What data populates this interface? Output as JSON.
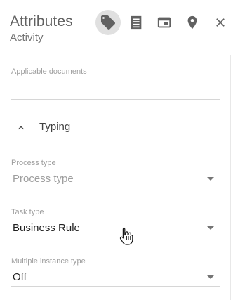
{
  "header": {
    "title": "Attributes",
    "subtitle": "Activity",
    "icons": [
      "tag-icon",
      "document-icon",
      "window-icon",
      "location-pin-icon",
      "close-icon"
    ],
    "active_tab": "tag-icon"
  },
  "fields": {
    "applicable_documents": {
      "label": "Applicable documents",
      "value": ""
    },
    "process_type": {
      "label": "Process type",
      "value": "Process type",
      "is_placeholder": true
    },
    "task_type": {
      "label": "Task type",
      "value": "Business Rule"
    },
    "multiple_instance_type": {
      "label": "Multiple instance type",
      "value": "Off"
    }
  },
  "section": {
    "title": "Typing",
    "expanded": true
  },
  "colors": {
    "icon": "#616161",
    "active_tab_bg": "#e0e0e0",
    "label": "#9e9e9e",
    "underline": "#d6d6d6"
  }
}
